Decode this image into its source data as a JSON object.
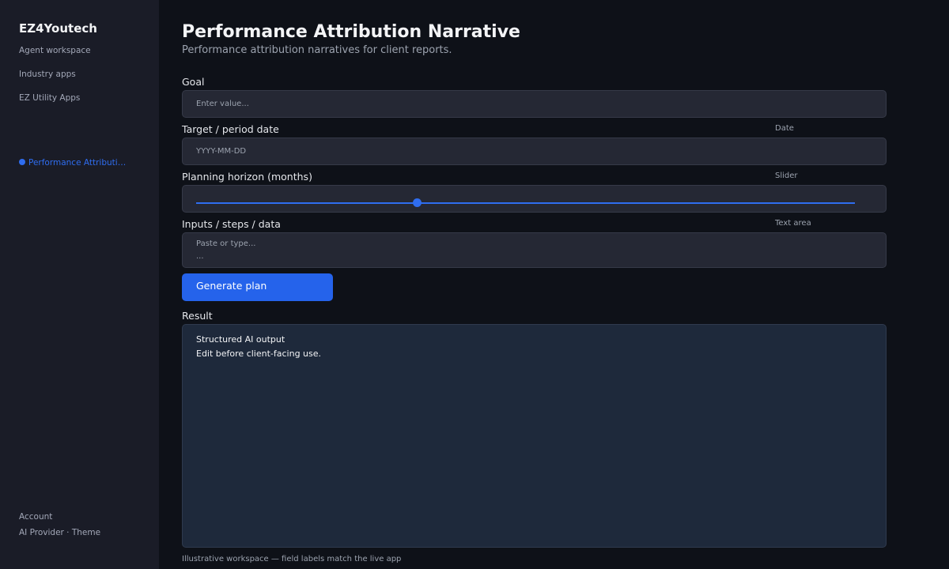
{
  "sidebar": {
    "brand": "EZ4Youtech",
    "items": [
      {
        "label": "Agent workspace"
      },
      {
        "label": "Industry apps"
      },
      {
        "label": "EZ Utility Apps"
      }
    ],
    "active_item": "Performance Attributio...",
    "footer": {
      "account": "Account",
      "provider_theme": "AI Provider · Theme"
    }
  },
  "header": {
    "title": "Performance Attribution Narrative",
    "subtitle": "Performance attribution narratives for client reports."
  },
  "form": {
    "goal": {
      "label": "Goal",
      "placeholder": "Enter value..."
    },
    "date": {
      "label": "Target / period date",
      "type_label": "Date",
      "placeholder": "YYYY-MM-DD"
    },
    "horizon": {
      "label": "Planning horizon (months)",
      "type_label": "Slider",
      "value_fraction": 0.336
    },
    "inputs": {
      "label": "Inputs / steps / data",
      "type_label": "Text area",
      "placeholder": "Paste or type...",
      "second_line": "..."
    },
    "generate_label": "Generate plan"
  },
  "result": {
    "label": "Result",
    "lines": [
      "Structured AI output",
      "Edit before client-facing use."
    ]
  },
  "footer_note": "Illustrative workspace — field labels match the live app",
  "colors": {
    "accent": "#2563eb",
    "background": "#0e1118",
    "sidebar": "#1a1c27",
    "field": "#252834",
    "result_panel": "#1e293b"
  }
}
